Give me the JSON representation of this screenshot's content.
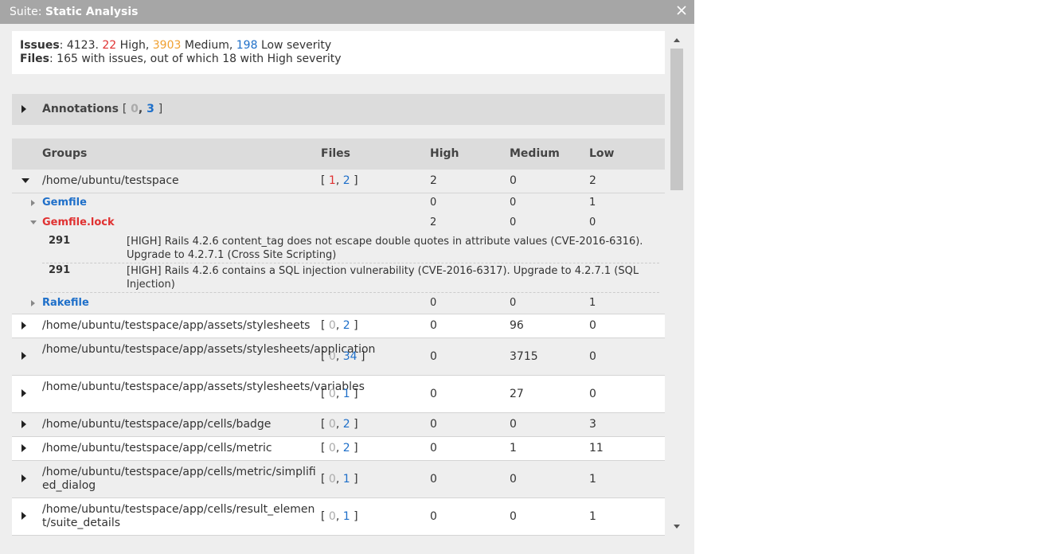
{
  "window": {
    "title_prefix": "Suite:",
    "title_name": "Static Analysis"
  },
  "summary": {
    "issues_label": "Issues",
    "issues_total": "4123.",
    "high_count": "22",
    "high_label": "High,",
    "medium_count": "3903",
    "medium_label": "Medium,",
    "low_count": "198",
    "low_label": "Low severity",
    "files_label": "Files",
    "files_text": "165 with issues, out of which 18 with High severity"
  },
  "annotations": {
    "label": "Annotations",
    "a": "0",
    "b": "3"
  },
  "table": {
    "headers": {
      "groups": "Groups",
      "files": "Files",
      "high": "High",
      "medium": "Medium",
      "low": "Low"
    },
    "expanded_group": {
      "path": "/home/ubuntu/testspace",
      "f1": "1",
      "f2": "2",
      "high": "2",
      "medium": "0",
      "low": "2",
      "files": [
        {
          "name": "Gemfile",
          "high": "0",
          "medium": "0",
          "low": "1"
        },
        {
          "name": "Gemfile.lock",
          "high": "2",
          "medium": "0",
          "low": "0"
        },
        {
          "name": "Rakefile",
          "high": "0",
          "medium": "0",
          "low": "1"
        }
      ],
      "issues": [
        {
          "line": "291",
          "text": "[HIGH] Rails 4.2.6 content_tag does not escape double quotes in attribute values (CVE-2016-6316). Upgrade to 4.2.7.1 (Cross Site Scripting)"
        },
        {
          "line": "291",
          "text": "[HIGH] Rails 4.2.6 contains a SQL injection vulnerability (CVE-2016-6317). Upgrade to 4.2.7.1 (SQL Injection)"
        }
      ]
    },
    "rows": [
      {
        "path": "/home/ubuntu/testspace/app/assets/stylesheets",
        "f1": "0",
        "f2": "2",
        "high": "0",
        "medium": "96",
        "low": "0"
      },
      {
        "path": "/home/ubuntu/testspace/app/assets/stylesheets/application",
        "f1": "0",
        "f2": "34",
        "high": "0",
        "medium": "3715",
        "low": "0"
      },
      {
        "path": "/home/ubuntu/testspace/app/assets/stylesheets/variables",
        "f1": "0",
        "f2": "1",
        "high": "0",
        "medium": "27",
        "low": "0"
      },
      {
        "path": "/home/ubuntu/testspace/app/cells/badge",
        "f1": "0",
        "f2": "2",
        "high": "0",
        "medium": "0",
        "low": "3"
      },
      {
        "path": "/home/ubuntu/testspace/app/cells/metric",
        "f1": "0",
        "f2": "2",
        "high": "0",
        "medium": "1",
        "low": "11"
      },
      {
        "path": "/home/ubuntu/testspace/app/cells/metric/simplified_dialog",
        "f1": "0",
        "f2": "1",
        "high": "0",
        "medium": "0",
        "low": "1"
      },
      {
        "path": "/home/ubuntu/testspace/app/cells/result_element/suite_details",
        "f1": "0",
        "f2": "1",
        "high": "0",
        "medium": "0",
        "low": "1"
      }
    ]
  },
  "colors": {
    "high": "#e03131",
    "medium": "#f0a030",
    "low": "#1e6fc9",
    "zero": "#aaaaaa",
    "file_link": "#1e6fc9"
  }
}
